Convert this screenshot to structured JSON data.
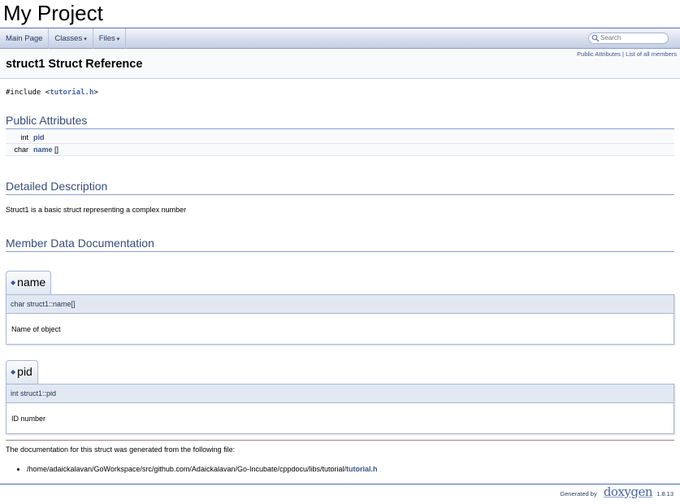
{
  "project": {
    "name": "My Project"
  },
  "navbar": {
    "items": [
      {
        "label": "Main Page"
      },
      {
        "label": "Classes",
        "dropdown": true
      },
      {
        "label": "Files",
        "dropdown": true
      }
    ],
    "search": {
      "placeholder": "Search",
      "icon": "search-icon"
    }
  },
  "header": {
    "summary": {
      "link1": "Public Attributes",
      "separator": "|",
      "link2": "List of all members"
    },
    "title": "struct1 Struct Reference"
  },
  "include": {
    "prefix": "#include <",
    "file": "tutorial.h",
    "suffix": ">"
  },
  "public_attributes": {
    "heading": "Public Attributes",
    "rows": [
      {
        "type": "int",
        "name": "pid",
        "suffix": ""
      },
      {
        "type": "char",
        "name": "name",
        "suffix": " []"
      }
    ]
  },
  "detailed": {
    "heading": "Detailed Description",
    "text": "Struct1 is a basic struct representing a complex number"
  },
  "member_doc": {
    "heading": "Member Data Documentation",
    "members": [
      {
        "title": "name",
        "proto": "char struct1::name[]",
        "doc": "Name of object"
      },
      {
        "title": "pid",
        "proto": "int struct1::pid",
        "doc": "ID number"
      }
    ]
  },
  "generated_note": "The documentation for this struct was generated from the following file:",
  "file_list": [
    {
      "path": "/home/adaickalavan/GoWorkspace/src/github.com/Adaickalavan/Go-Incubate/cppdocu/libs/tutorial/",
      "file": "tutorial.h"
    }
  ],
  "footer": {
    "generated_by": "Generated by",
    "logo": "doxygen",
    "version": "1.8.13"
  },
  "colors": {
    "link": "#3D578C",
    "heading": "#354C7B",
    "accent_border": "#879ECB"
  }
}
